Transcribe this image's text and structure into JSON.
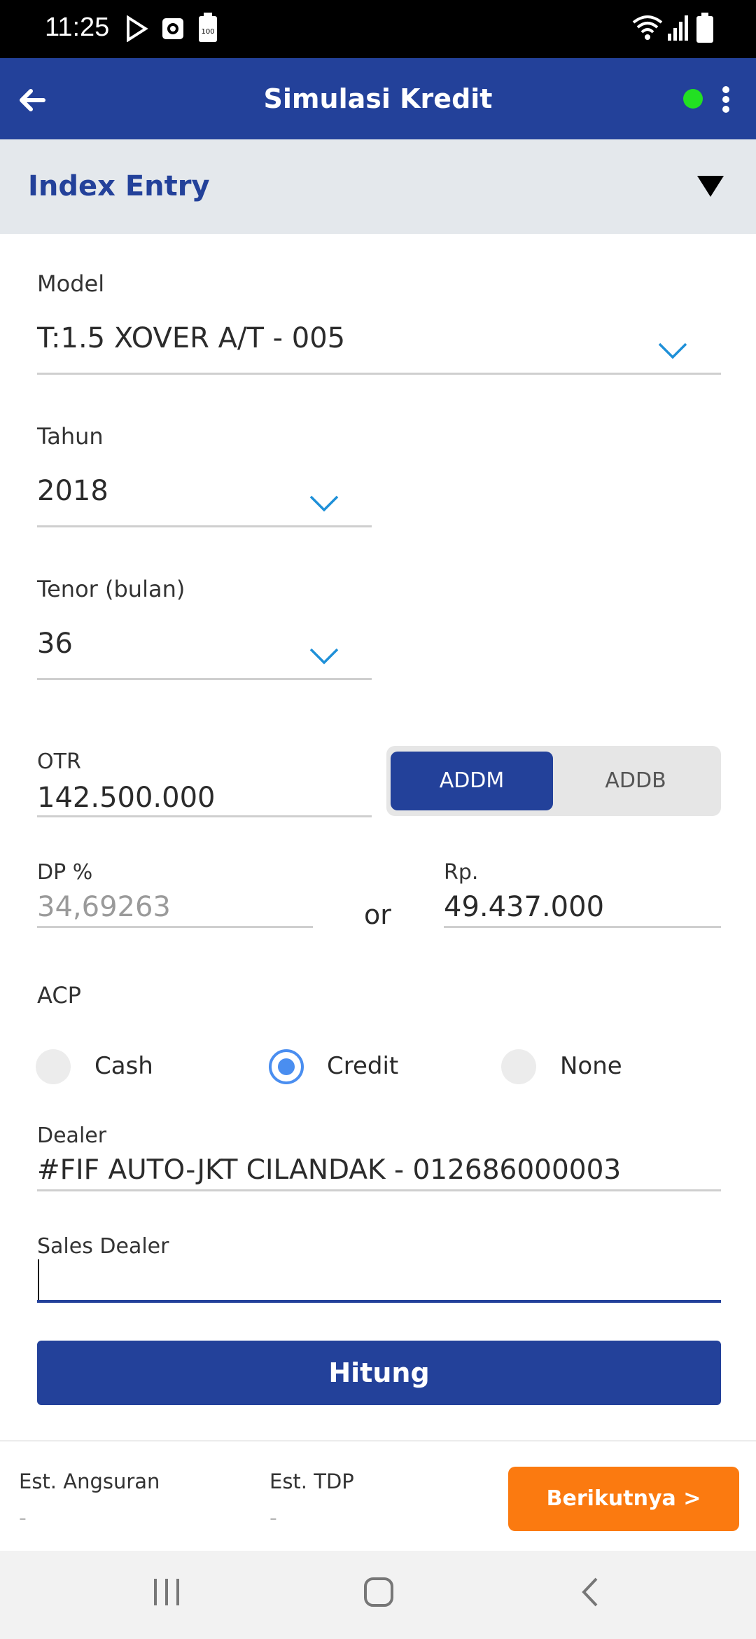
{
  "status_bar": {
    "time": "11:25",
    "battery_badge": "100"
  },
  "header": {
    "title": "Simulasi Kredit",
    "status_color": "#22e022",
    "accent": "#23419a"
  },
  "section": {
    "title": "Index Entry"
  },
  "form": {
    "model": {
      "label": "Model",
      "value": "T:1.5 XOVER A/T - 005"
    },
    "tahun": {
      "label": "Tahun",
      "value": "2018"
    },
    "tenor": {
      "label": "Tenor (bulan)",
      "value": "36"
    },
    "otr": {
      "label": "OTR",
      "value": "142.500.000"
    },
    "toggle": {
      "options": [
        "ADDM",
        "ADDB"
      ],
      "selected": "ADDM"
    },
    "dp_percent": {
      "label": "DP %",
      "value": "34,69263"
    },
    "or_text": "or",
    "dp_rp": {
      "label": "Rp.",
      "value": "49.437.000"
    },
    "acp": {
      "label": "ACP",
      "options": [
        "Cash",
        "Credit",
        "None"
      ],
      "selected": "Credit"
    },
    "dealer": {
      "label": "Dealer",
      "value": "#FIF AUTO-JKT CILANDAK - 012686000003"
    },
    "sales_dealer": {
      "label": "Sales Dealer",
      "value": ""
    },
    "submit_label": "Hitung"
  },
  "summary": {
    "angsuran": {
      "label": "Est. Angsuran",
      "value": "-"
    },
    "tdp": {
      "label": "Est. TDP",
      "value": "-"
    },
    "next_label": "Berikutnya >",
    "next_color": "#fb7a10"
  }
}
